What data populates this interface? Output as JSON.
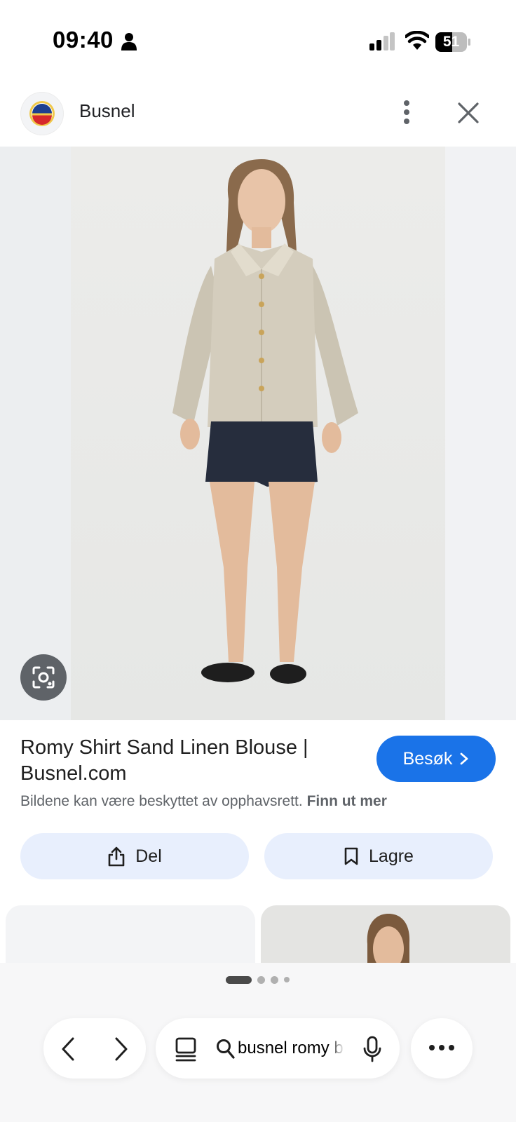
{
  "status_bar": {
    "time": "09:40",
    "battery": "51"
  },
  "header": {
    "site_name": "Busnel"
  },
  "result": {
    "title": "Romy Shirt Sand Linen Blouse | Busnel.com",
    "visit_label": "Besøk",
    "copyright_text": "Bildene kan være beskyttet av opphavsrett.",
    "learn_more": "Finn ut mer"
  },
  "actions": {
    "share_label": "Del",
    "save_label": "Lagre"
  },
  "pagination": {
    "dots": 4,
    "active": 0
  },
  "toolbar": {
    "search_query": "busnel romy b"
  },
  "colors": {
    "accent": "#1a73e8",
    "pill_bg": "#e8effd",
    "lens_bg": "#5f6368"
  },
  "icons": [
    "person-icon",
    "signal-icon",
    "wifi-icon",
    "battery-icon",
    "more-vert-icon",
    "close-icon",
    "lens-icon",
    "chevron-right-icon",
    "share-icon",
    "bookmark-icon",
    "back-icon",
    "forward-icon",
    "tabs-icon",
    "search-icon",
    "mic-icon",
    "more-horiz-icon"
  ]
}
